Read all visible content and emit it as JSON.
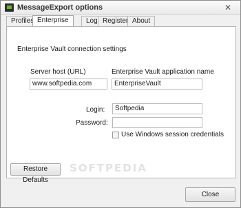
{
  "window": {
    "title": "MessageExport options"
  },
  "tabs": [
    "Profiles",
    "Enterprise Vault",
    "Log",
    "Register",
    "About"
  ],
  "section": {
    "heading": "Enterprise Vault connection settings"
  },
  "server": {
    "label": "Server host (URL)",
    "value": "www.softpedia.com",
    "separator": "/"
  },
  "app_name": {
    "label": "Enterprise Vault application name",
    "value": "EnterpriseVault"
  },
  "login": {
    "label": "Login:",
    "value": "Softpedia"
  },
  "password": {
    "label": "Password:",
    "value": ""
  },
  "session_checkbox": {
    "label": "Use Windows session credentials",
    "checked": false
  },
  "buttons": {
    "restore_defaults": "Restore Defaults",
    "close": "Close"
  },
  "watermark": "SOFTPEDIA",
  "icons": {
    "close": "close-icon",
    "app": "app-icon"
  }
}
